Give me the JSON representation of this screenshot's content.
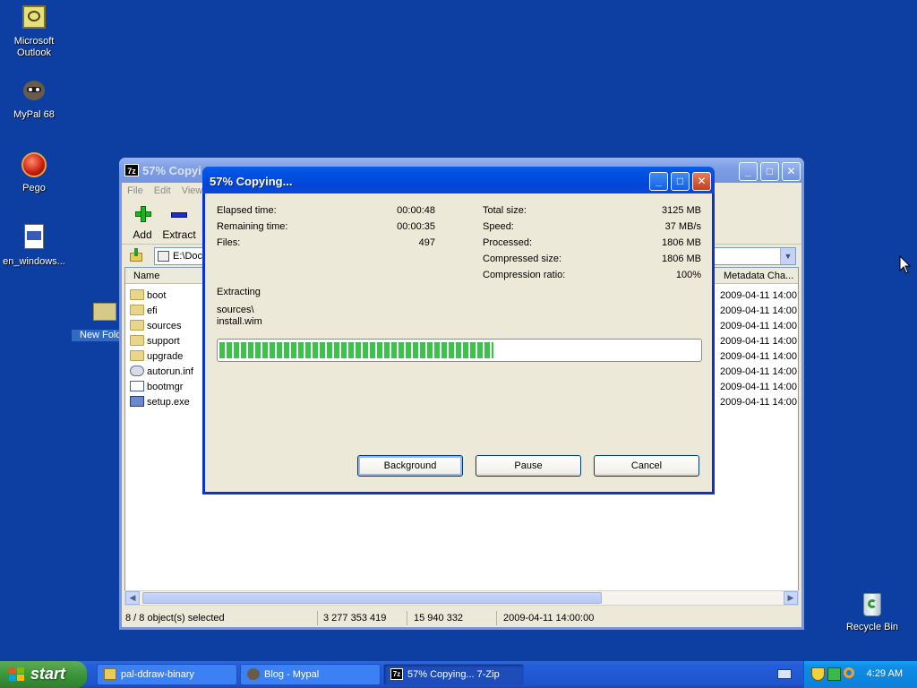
{
  "desktop": {
    "icons": [
      {
        "label": "Microsoft Outlook",
        "icon": "outlook-icon"
      },
      {
        "label": "MyPal 68",
        "icon": "raccoon-icon"
      },
      {
        "label": "Pego",
        "icon": "pego-icon"
      },
      {
        "label": "en_windows...",
        "icon": "iso-file-icon"
      },
      {
        "label": "New Fold",
        "icon": "folder-icon"
      },
      {
        "label": "Recycle Bin",
        "icon": "recycle-bin-icon"
      }
    ]
  },
  "main_window": {
    "title": "57% Copyi",
    "app_icon_text": "7z",
    "menu": [
      "File",
      "Edit",
      "View"
    ],
    "toolbar": {
      "add_label": "Add",
      "extract_label": "Extract"
    },
    "address": "E:\\Docu",
    "columns": {
      "name": "Name",
      "metadata": "Metadata Cha..."
    },
    "files": [
      {
        "name": "boot",
        "type": "folder",
        "date": "2009-04-11 14:00"
      },
      {
        "name": "efi",
        "type": "folder",
        "date": "2009-04-11 14:00"
      },
      {
        "name": "sources",
        "type": "folder",
        "date": "2009-04-11 14:00"
      },
      {
        "name": "support",
        "type": "folder",
        "date": "2009-04-11 14:00"
      },
      {
        "name": "upgrade",
        "type": "folder",
        "date": "2009-04-11 14:00"
      },
      {
        "name": "autorun.inf",
        "type": "settings",
        "date": "2009-04-11 14:00"
      },
      {
        "name": "bootmgr",
        "type": "file",
        "date": "2009-04-11 14:00"
      },
      {
        "name": "setup.exe",
        "type": "exe",
        "date": "2009-04-11 14:00"
      }
    ],
    "status": {
      "selection": "8 / 8 object(s) selected",
      "size": "3 277 353 419",
      "packed": "15 940 332",
      "date": "2009-04-11 14:00:00"
    }
  },
  "progress_dialog": {
    "title": "57% Copying...",
    "left_stats": [
      {
        "label": "Elapsed time:",
        "value": "00:00:48"
      },
      {
        "label": "Remaining time:",
        "value": "00:00:35"
      },
      {
        "label": "Files:",
        "value": "497"
      }
    ],
    "right_stats": [
      {
        "label": "Total size:",
        "value": "3125 MB"
      },
      {
        "label": "Speed:",
        "value": "37 MB/s"
      },
      {
        "label": "Processed:",
        "value": "1806 MB"
      },
      {
        "label": "Compressed size:",
        "value": "1806 MB"
      },
      {
        "label": "Compression ratio:",
        "value": "100%"
      }
    ],
    "operation": "Extracting",
    "current_path": "sources\\",
    "current_file": "install.wim",
    "progress_fraction": 0.57,
    "buttons": {
      "background": "Background",
      "pause": "Pause",
      "cancel": "Cancel"
    }
  },
  "taskbar": {
    "start_label": "start",
    "tasks": [
      {
        "label": "pal-ddraw-binary",
        "active": false
      },
      {
        "label": "Blog - Mypal",
        "active": false
      },
      {
        "label": "57% Copying... 7-Zip",
        "active": true
      }
    ],
    "clock": "4:29 AM"
  }
}
